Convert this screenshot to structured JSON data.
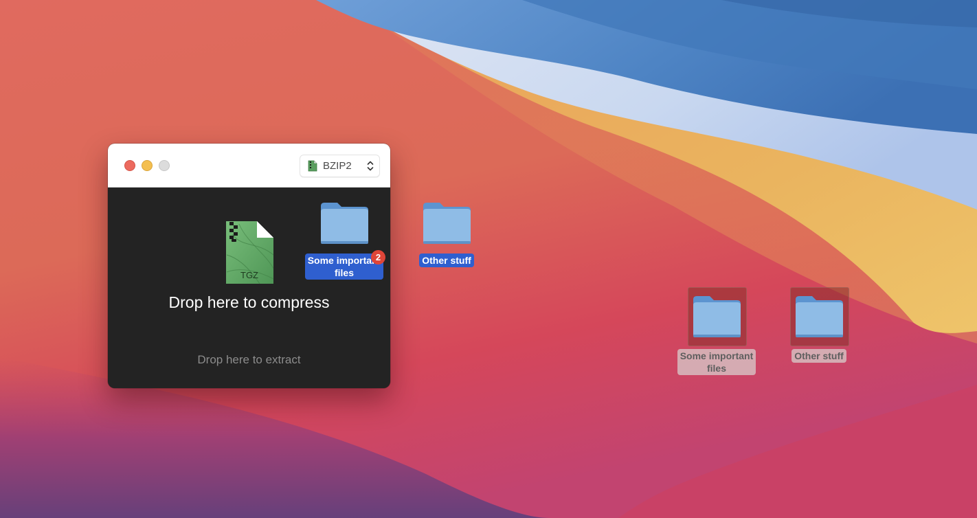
{
  "window": {
    "format_selector": {
      "value": "BZIP2",
      "icon": "green-archive-doc-icon"
    },
    "drop_compress": {
      "icon_label": "TGZ",
      "label": "Drop here to compress"
    },
    "drop_extract": {
      "label": "Drop here to extract"
    }
  },
  "dragging_items": {
    "items": [
      {
        "label_line1": "Some important",
        "label_line2": "files"
      },
      {
        "label_line1": "Other stuff"
      }
    ],
    "count_badge": "2"
  },
  "desktop": {
    "items": [
      {
        "label_line1": "Some important",
        "label_line2": "files"
      },
      {
        "label_line1": "Other stuff"
      }
    ]
  },
  "colors": {
    "close": "#ec6a5e",
    "minimize": "#f4bf4f",
    "zoom": "#dcdcdc",
    "selection": "#2f5fcf",
    "badge": "#de4538",
    "window_body": "#232323",
    "tgz_green": "#68b06d"
  }
}
